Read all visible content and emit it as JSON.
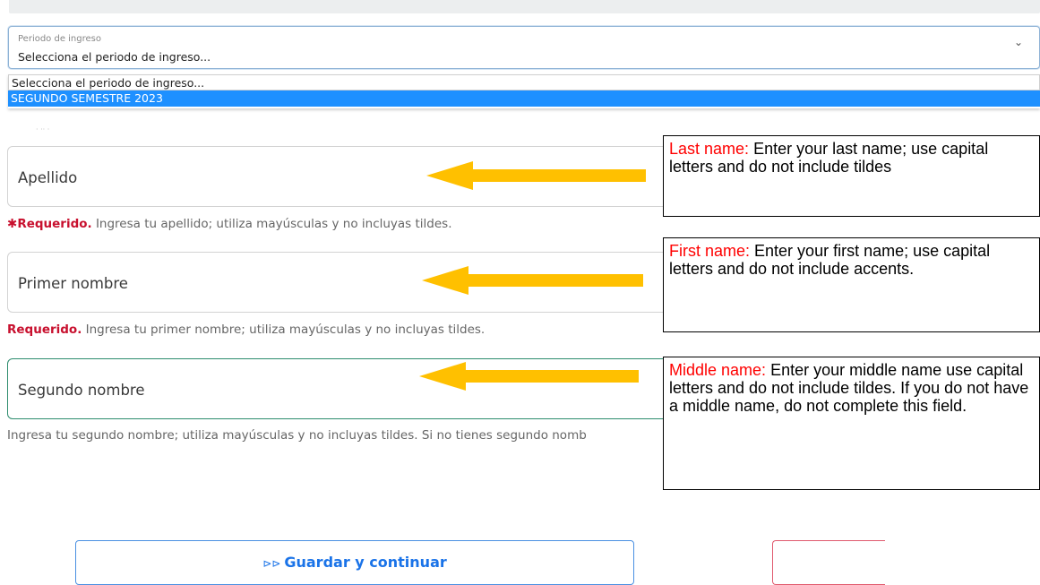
{
  "select": {
    "floating_label": "Periodo de ingreso",
    "value": "Selecciona el periodo de ingreso...",
    "options": [
      "Selecciona el periodo de ingreso...",
      "SEGUNDO SEMESTRE 2023"
    ]
  },
  "fields": [
    {
      "label": "Apellido",
      "help_required_mark": "✱",
      "help_required": "Requerido.",
      "help_text": " Ingresa tu apellido; utiliza mayúsculas y no incluyas tildes."
    },
    {
      "label": "Primer nombre",
      "help_required": "Requerido.",
      "help_text": " Ingresa tu primer nombre; utiliza mayúsculas y no incluyas tildes."
    },
    {
      "label": "Segundo nombre",
      "help_text": "Ingresa tu segundo nombre; utiliza mayúsculas y no incluyas tildes. Si no tienes segundo nomb"
    }
  ],
  "callouts": [
    {
      "title": "Last name:",
      "text": " Enter your last name; use capital letters and do not include tildes"
    },
    {
      "title": "First name:",
      "text": " Enter your first name; use capital letters and do not include accents."
    },
    {
      "title": "Middle name:",
      "text": " Enter your middle name use capital letters and do not include tildes. If you do not have a middle name, do not complete this field."
    }
  ],
  "buttons": {
    "save_icon": "⊳⊳",
    "save_label": "Guardar y continuar"
  },
  "colors": {
    "arrow": "#FFC000",
    "accent": "#1a73e8",
    "required": "#c8102e",
    "callout_title": "#ff0000"
  }
}
